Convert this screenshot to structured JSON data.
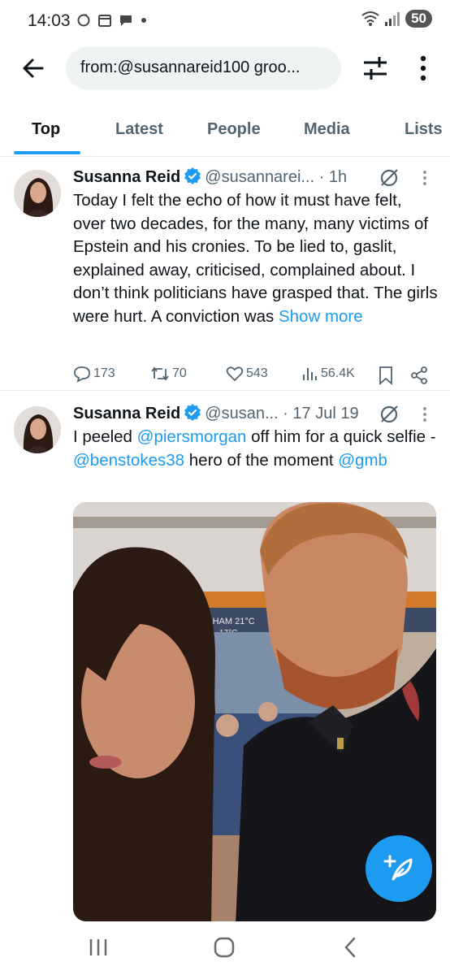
{
  "status_bar": {
    "time": "14:03",
    "battery": "50"
  },
  "search": {
    "query": "from:@susannareid100 groo..."
  },
  "tabs": [
    {
      "label": "Top",
      "active": true
    },
    {
      "label": "Latest",
      "active": false
    },
    {
      "label": "People",
      "active": false
    },
    {
      "label": "Media",
      "active": false
    },
    {
      "label": "Lists",
      "active": false
    }
  ],
  "tweets": [
    {
      "name": "Susanna Reid",
      "handle": "@susannarei...",
      "time": "· 1h",
      "text": "Today I felt the echo of how it must have felt, over two decades, for the many, many victims of Epstein and his cronies. To be lied to, gaslit, explained away, criticised, complained about. I don’t think politicians have grasped that. The girls were hurt. A conviction was",
      "show_more": "Show more",
      "replies": "173",
      "reposts": "70",
      "likes": "543",
      "views": "56.4K"
    },
    {
      "name": "Susanna Reid",
      "handle": "@susan...",
      "time": "· 17 Jul 19",
      "text_1": "I peeled ",
      "mention_1": "@piersmorgan",
      "text_2": " off him for a quick selfie - ",
      "mention_2": "@benstokes38",
      "text_3": " hero of the moment ",
      "mention_3": "@gmb",
      "photo_tv_text": "IGHAM 21°C",
      "photo_tv_text_2": "17°C"
    }
  ],
  "colors": {
    "accent": "#1d9bf0",
    "text": "#0f1419",
    "secondary": "#536471"
  }
}
